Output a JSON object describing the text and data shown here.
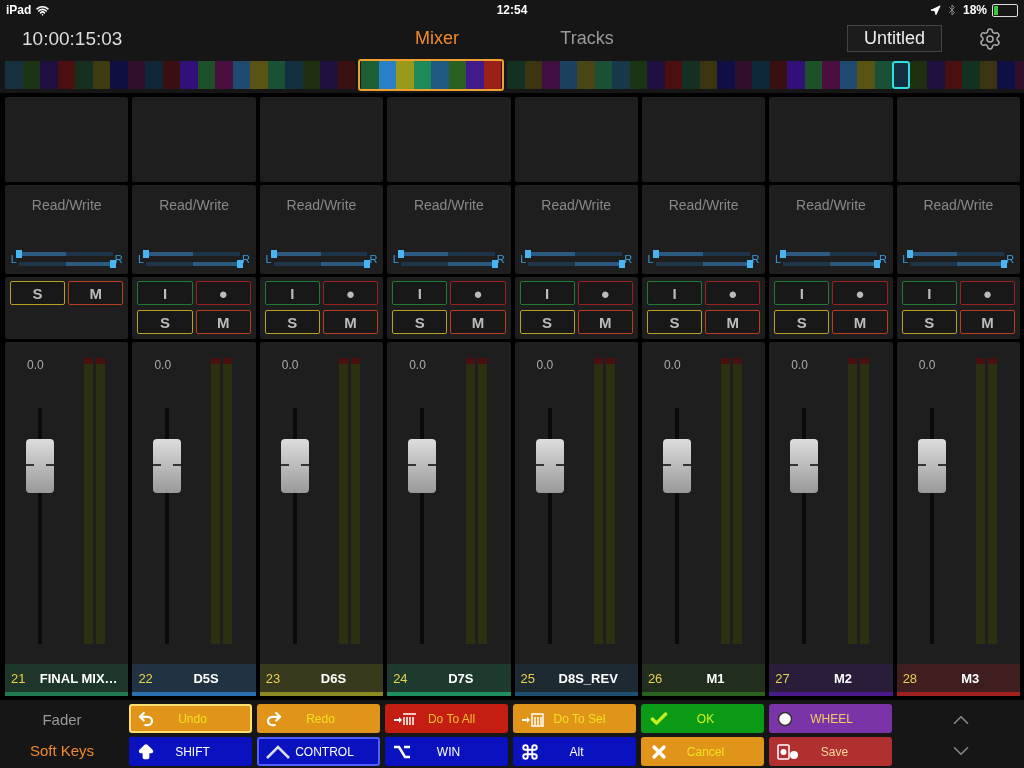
{
  "status_bar": {
    "device": "iPad",
    "time": "12:54",
    "battery": "18%"
  },
  "header": {
    "timecode": "10:00:15:03",
    "tabs": [
      {
        "label": "Mixer",
        "selected": true
      },
      {
        "label": "Tracks",
        "selected": false
      }
    ],
    "document": "Untitled"
  },
  "overview": {
    "groups": [
      {
        "selected": false,
        "cells": [
          {
            "color": "#17303f",
            "selected": false
          },
          {
            "color": "#1d3316",
            "selected": false
          },
          {
            "color": "#1f0f3f",
            "selected": false
          },
          {
            "color": "#4a1010",
            "selected": false
          },
          {
            "color": "#15301f",
            "selected": false
          },
          {
            "color": "#3f3a10",
            "selected": false
          },
          {
            "color": "#0e0f40",
            "selected": false
          },
          {
            "color": "#2f0f2a",
            "selected": false
          },
          {
            "color": "#0f2838",
            "selected": false
          },
          {
            "color": "#3a0f0f",
            "selected": false
          },
          {
            "color": "#32107a",
            "selected": false
          },
          {
            "color": "#1c5028",
            "selected": false
          },
          {
            "color": "#4a0f3f",
            "selected": false
          },
          {
            "color": "#204a70",
            "selected": false
          },
          {
            "color": "#5a5414",
            "selected": false
          },
          {
            "color": "#1a5036",
            "selected": false
          },
          {
            "color": "#123040",
            "selected": false
          },
          {
            "color": "#1f3010",
            "selected": false
          },
          {
            "color": "#1f1040",
            "selected": false
          },
          {
            "color": "#3a1010",
            "selected": false
          }
        ]
      },
      {
        "selected": true,
        "cells": [
          {
            "color": "#1e5e34",
            "selected": false
          },
          {
            "color": "#2a80c6",
            "selected": false
          },
          {
            "color": "#9a9a1a",
            "selected": false
          },
          {
            "color": "#1e8a5a",
            "selected": false
          },
          {
            "color": "#205a80",
            "selected": false
          },
          {
            "color": "#2a6020",
            "selected": false
          },
          {
            "color": "#401a8a",
            "selected": false
          },
          {
            "color": "#9a2018",
            "selected": false
          }
        ]
      },
      {
        "selected": false,
        "cells": [
          {
            "color": "#143020",
            "selected": false
          },
          {
            "color": "#3a3510",
            "selected": false
          },
          {
            "color": "#3f0f40",
            "selected": false
          },
          {
            "color": "#1c4060",
            "selected": false
          },
          {
            "color": "#4a4514",
            "selected": false
          },
          {
            "color": "#1a5036",
            "selected": false
          },
          {
            "color": "#163848",
            "selected": false
          },
          {
            "color": "#1a3414",
            "selected": false
          },
          {
            "color": "#1f1040",
            "selected": false
          },
          {
            "color": "#4a1010",
            "selected": false
          },
          {
            "color": "#143020",
            "selected": false
          },
          {
            "color": "#3a3510",
            "selected": false
          },
          {
            "color": "#0f0f45",
            "selected": false
          },
          {
            "color": "#2f0f2a",
            "selected": false
          },
          {
            "color": "#0f2838",
            "selected": false
          },
          {
            "color": "#3a0f0f",
            "selected": false
          },
          {
            "color": "#32107a",
            "selected": false
          },
          {
            "color": "#1c5028",
            "selected": false
          },
          {
            "color": "#4a0f3f",
            "selected": false
          },
          {
            "color": "#204a70",
            "selected": false
          },
          {
            "color": "#5a5414",
            "selected": false
          },
          {
            "color": "#1a5036",
            "selected": false
          },
          {
            "color": "#123040",
            "selected": true
          },
          {
            "color": "#1f3010",
            "selected": false
          },
          {
            "color": "#1f1040",
            "selected": false
          },
          {
            "color": "#4a1010",
            "selected": false
          },
          {
            "color": "#143020",
            "selected": false
          },
          {
            "color": "#3a3510",
            "selected": false
          },
          {
            "color": "#0e0f45",
            "selected": false
          },
          {
            "color": "#2f0f2a",
            "selected": false
          }
        ]
      }
    ]
  },
  "channels": [
    {
      "number": "21",
      "name": "FINAL MIX…",
      "color": "#1f7a50",
      "automation": "Read/Write",
      "pan_labels": [
        "L",
        "R"
      ],
      "pan": [
        {
          "level": 0
        },
        {
          "level": 1
        }
      ],
      "buttons": [
        {
          "kind": "solo",
          "label": "S"
        },
        {
          "kind": "mute",
          "label": "M"
        }
      ],
      "value": "0.0",
      "level": 0.83
    },
    {
      "number": "22",
      "name": "D5S",
      "color": "#2a70b0",
      "automation": "Read/Write",
      "pan_labels": [
        "L",
        "R"
      ],
      "pan": [
        {
          "level": 0
        },
        {
          "level": 1
        }
      ],
      "buttons": [
        {
          "kind": "input",
          "label": "I"
        },
        {
          "kind": "record",
          "label": "●"
        },
        {
          "kind": "solo",
          "label": "S"
        },
        {
          "kind": "mute",
          "label": "M"
        }
      ],
      "value": "0.0",
      "level": 0.83
    },
    {
      "number": "23",
      "name": "D6S",
      "color": "#8a8a20",
      "automation": "Read/Write",
      "pan_labels": [
        "L",
        "R"
      ],
      "pan": [
        {
          "level": 0
        },
        {
          "level": 1
        }
      ],
      "buttons": [
        {
          "kind": "input",
          "label": "I"
        },
        {
          "kind": "record",
          "label": "●"
        },
        {
          "kind": "solo",
          "label": "S"
        },
        {
          "kind": "mute",
          "label": "M"
        }
      ],
      "value": "0.0",
      "level": 0.83
    },
    {
      "number": "24",
      "name": "D7S",
      "color": "#1e9060",
      "automation": "Read/Write",
      "pan_labels": [
        "L",
        "R"
      ],
      "pan": [
        {
          "level": 0
        },
        {
          "level": 1
        }
      ],
      "buttons": [
        {
          "kind": "input",
          "label": "I"
        },
        {
          "kind": "record",
          "label": "●"
        },
        {
          "kind": "solo",
          "label": "S"
        },
        {
          "kind": "mute",
          "label": "M"
        }
      ],
      "value": "0.0",
      "level": 0.83
    },
    {
      "number": "25",
      "name": "D8S_REV",
      "color": "#1e4f70",
      "automation": "Read/Write",
      "pan_labels": [
        "L",
        "R"
      ],
      "pan": [
        {
          "level": 0
        },
        {
          "level": 1
        }
      ],
      "buttons": [
        {
          "kind": "input",
          "label": "I"
        },
        {
          "kind": "record",
          "label": "●"
        },
        {
          "kind": "solo",
          "label": "S"
        },
        {
          "kind": "mute",
          "label": "M"
        }
      ],
      "value": "0.0",
      "level": 0.83
    },
    {
      "number": "26",
      "name": "M1",
      "color": "#2a6020",
      "automation": "Read/Write",
      "pan_labels": [
        "L",
        "R"
      ],
      "pan": [
        {
          "level": 0
        },
        {
          "level": 1
        }
      ],
      "buttons": [
        {
          "kind": "input",
          "label": "I"
        },
        {
          "kind": "record",
          "label": "●"
        },
        {
          "kind": "solo",
          "label": "S"
        },
        {
          "kind": "mute",
          "label": "M"
        }
      ],
      "value": "0.0",
      "level": 0.83
    },
    {
      "number": "27",
      "name": "M2",
      "color": "#4a1a8a",
      "automation": "Read/Write",
      "pan_labels": [
        "L",
        "R"
      ],
      "pan": [
        {
          "level": 0
        },
        {
          "level": 1
        }
      ],
      "buttons": [
        {
          "kind": "input",
          "label": "I"
        },
        {
          "kind": "record",
          "label": "●"
        },
        {
          "kind": "solo",
          "label": "S"
        },
        {
          "kind": "mute",
          "label": "M"
        }
      ],
      "value": "0.0",
      "level": 0.83
    },
    {
      "number": "28",
      "name": "M3",
      "color": "#a02020",
      "automation": "Read/Write",
      "pan_labels": [
        "L",
        "R"
      ],
      "pan": [
        {
          "level": 0
        },
        {
          "level": 1
        }
      ],
      "buttons": [
        {
          "kind": "input",
          "label": "I"
        },
        {
          "kind": "record",
          "label": "●"
        },
        {
          "kind": "solo",
          "label": "S"
        },
        {
          "kind": "mute",
          "label": "M"
        }
      ],
      "value": "0.0",
      "level": 0.83
    }
  ],
  "modes": [
    {
      "label": "Fader",
      "selected": false
    },
    {
      "label": "Soft Keys",
      "selected": true
    }
  ],
  "soft_keys": [
    {
      "label": "Undo",
      "kind": "undo",
      "color": "#e0951a",
      "active": true
    },
    {
      "label": "Redo",
      "kind": "redo",
      "color": "#e0951a",
      "active": false
    },
    {
      "label": "Do To All",
      "kind": "do-all",
      "color": "#c41e12",
      "active": false
    },
    {
      "label": "Do To Sel",
      "kind": "do-sel",
      "color": "#e0951a",
      "active": false
    },
    {
      "label": "OK",
      "kind": "ok",
      "color": "#0a9a16",
      "active": false
    },
    {
      "label": "WHEEL",
      "kind": "wheel",
      "color": "#7a34a8",
      "active": false
    },
    {
      "label": "SHIFT",
      "kind": "shift",
      "color": "#0a12c0",
      "active": false
    },
    {
      "label": "CONTROL",
      "kind": "control",
      "color": "#0a12c0",
      "active": true
    },
    {
      "label": "WIN",
      "kind": "option",
      "color": "#0a12c0",
      "active": false
    },
    {
      "label": "Alt",
      "kind": "command",
      "color": "#0a12c0",
      "active": false
    },
    {
      "label": "Cancel",
      "kind": "cancel",
      "color": "#e0951a",
      "active": false
    },
    {
      "label": "Save",
      "kind": "save",
      "color": "#b03030",
      "active": false
    }
  ]
}
